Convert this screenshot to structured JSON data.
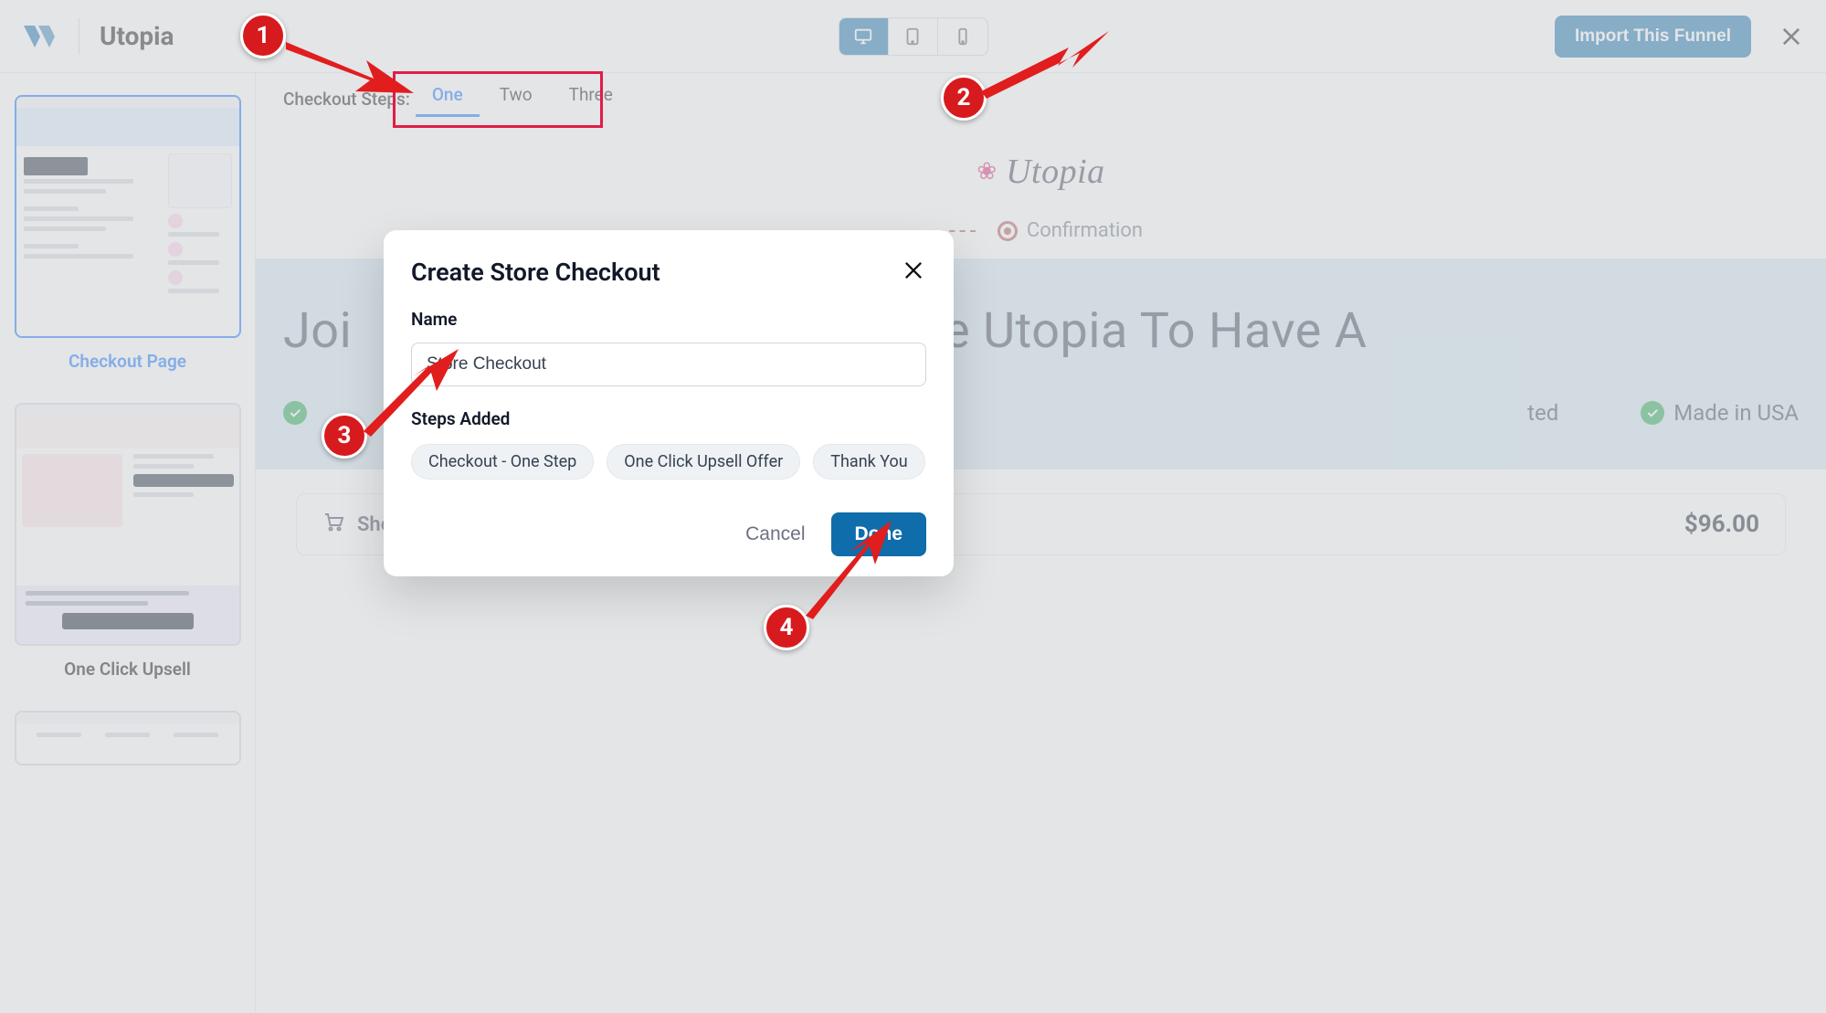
{
  "topbar": {
    "funnel_name": "Utopia",
    "import_label": "Import This Funnel"
  },
  "sidebar": {
    "pages": [
      {
        "title": "Checkout Page",
        "active": true
      },
      {
        "title": "One Click Upsell",
        "active": false
      }
    ]
  },
  "steps": {
    "label": "Checkout Steps:",
    "tabs": [
      "One",
      "Two",
      "Three"
    ],
    "active": "One"
  },
  "preview": {
    "brand": "Utopia",
    "progress_last": "Confirmation",
    "headline_left": "Joi",
    "headline_right": "e Utopia To Have A",
    "features": {
      "right1": "ted",
      "right2": "Made in USA"
    },
    "summary_label": "Show Order Summary",
    "summary_price": "$96.00"
  },
  "modal": {
    "title": "Create Store Checkout",
    "name_label": "Name",
    "name_value": "Store Checkout",
    "steps_label": "Steps Added",
    "chips": [
      "Checkout - One Step",
      "One Click Upsell Offer",
      "Thank You"
    ],
    "cancel": "Cancel",
    "done": "Done"
  },
  "annotations": {
    "b1": "1",
    "b2": "2",
    "b3": "3",
    "b4": "4"
  }
}
